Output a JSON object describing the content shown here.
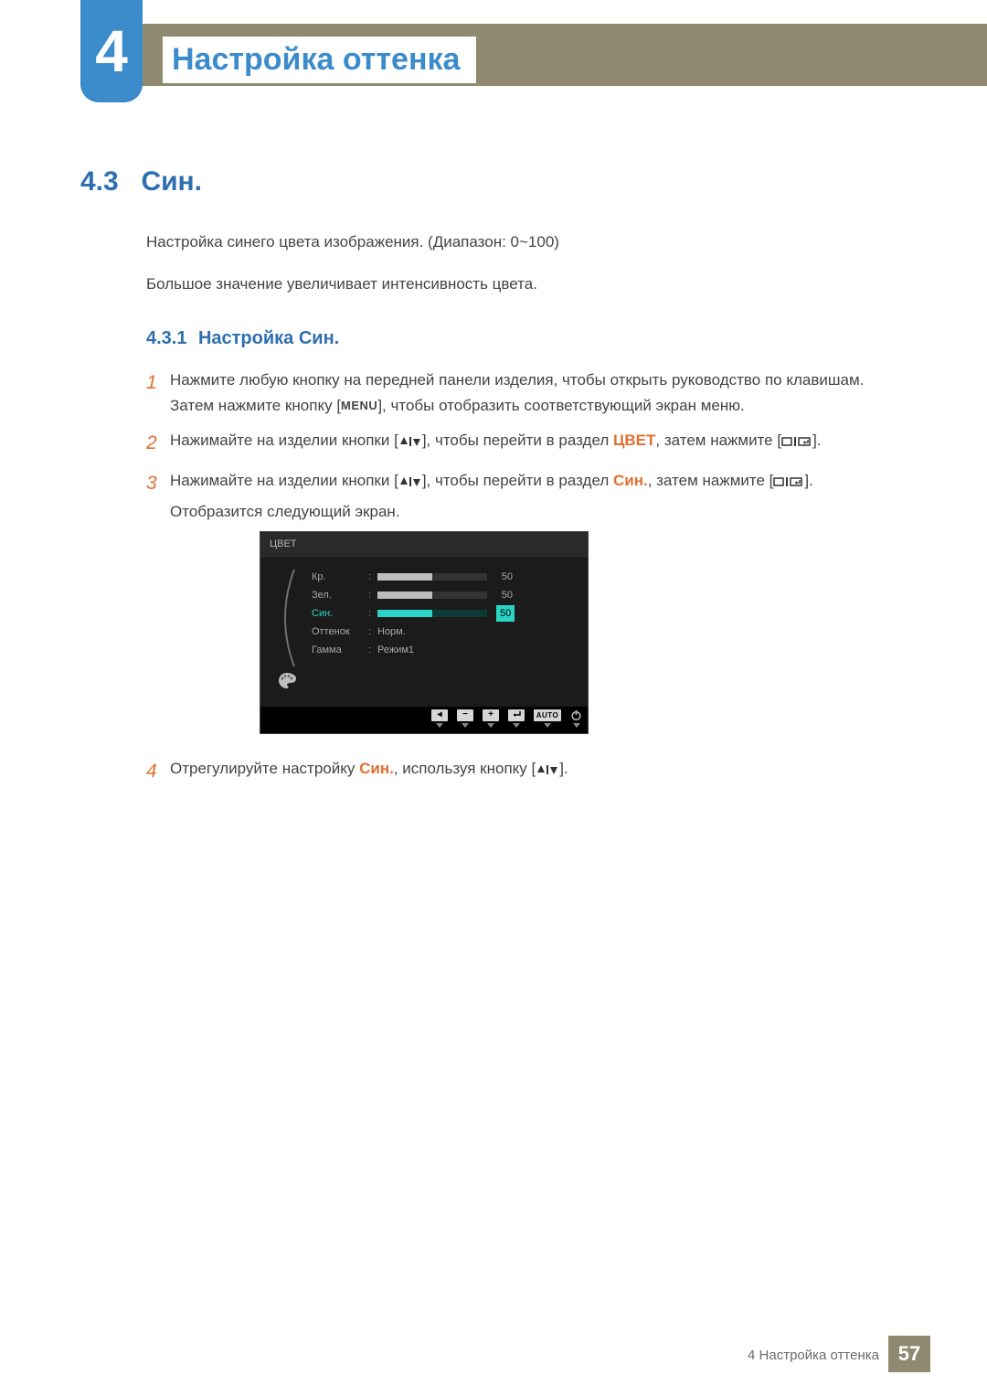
{
  "chapter": {
    "number": "4",
    "title": "Настройка оттенка"
  },
  "section": {
    "number": "4.3",
    "title": "Син."
  },
  "intro": {
    "p1": "Настройка синего цвета изображения. (Диапазон: 0~100)",
    "p2": "Большое значение увеличивает интенсивность цвета."
  },
  "subsection": {
    "number": "4.3.1",
    "title": "Настройка Син."
  },
  "steps": {
    "s1": {
      "num": "1",
      "a": "Нажмите любую кнопку на передней панели изделия, чтобы открыть руководство по клавишам. Затем нажмите кнопку [",
      "menu": "MENU",
      "b": "], чтобы отобразить соответствующий экран меню."
    },
    "s2": {
      "num": "2",
      "a": "Нажимайте на изделии кнопки [",
      "b": "], чтобы перейти в раздел ",
      "hl": "ЦВЕТ",
      "c": ", затем нажмите [",
      "d": "]."
    },
    "s3": {
      "num": "3",
      "a": "Нажимайте на изделии кнопки [",
      "b": "], чтобы перейти в раздел ",
      "hl": "Син.",
      "c": ", затем нажмите [",
      "d": "].",
      "e": "Отобразится следующий экран."
    },
    "s4": {
      "num": "4",
      "a": "Отрегулируйте настройку ",
      "hl": "Син.",
      "b": ", используя кнопку [",
      "c": "]."
    }
  },
  "osd": {
    "title": "ЦВЕТ",
    "rows": [
      {
        "label": "Кр.",
        "value": "50",
        "pct": 50,
        "type": "bar",
        "active": false
      },
      {
        "label": "Зел.",
        "value": "50",
        "pct": 50,
        "type": "bar",
        "active": false
      },
      {
        "label": "Син.",
        "value": "50",
        "pct": 50,
        "type": "bar",
        "active": true
      },
      {
        "label": "Оттенок",
        "value": "Норм.",
        "type": "text",
        "active": false
      },
      {
        "label": "Гамма",
        "value": "Режим1",
        "type": "text",
        "active": false
      }
    ],
    "footer_auto": "AUTO"
  },
  "footer": {
    "label": "4 Настройка оттенка",
    "page": "57"
  }
}
